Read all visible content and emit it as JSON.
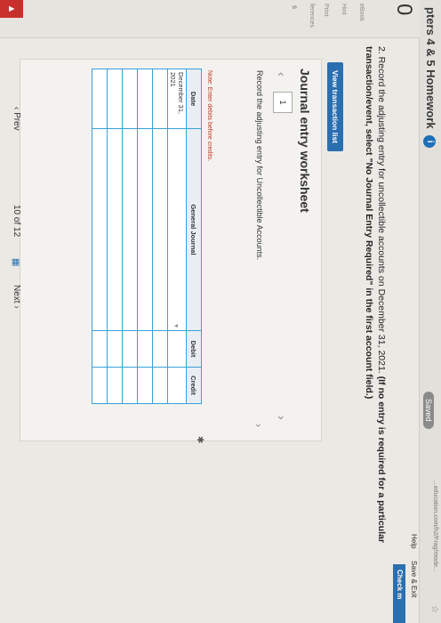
{
  "header": {
    "title": "pters 4 & 5 Homework",
    "info_badge": "i",
    "saved_label": "Saved",
    "url_fragment": "...education.com/h2/Frag/mode...",
    "help_label": "Help",
    "save_exit_label": "Save & Exit",
    "check_label": "Check m"
  },
  "sidebar": {
    "question_number": "0",
    "items": [
      "eBook",
      "Hint",
      "Print",
      "ferences"
    ],
    "section_letter": "s"
  },
  "question": {
    "text_prefix": "2. Record the adjusting entry for uncollectible accounts on December 31, 2021. ",
    "text_bold": "(If no entry is required for a particular transaction/event, select \"No Journal Entry Required\" in the first account field.)"
  },
  "view_transaction_label": "View transaction list",
  "worksheet": {
    "title": "Journal entry worksheet",
    "page": "1",
    "instruction": "Record the adjusting entry for Uncollectible Accounts.",
    "note": "Note: Enter debits before credits.",
    "columns": [
      "Date",
      "General Journal",
      "Debit",
      "Credit"
    ],
    "rows": [
      {
        "date": "December 31, 2021",
        "account": "",
        "debit": "",
        "credit": ""
      },
      {
        "date": "",
        "account": "",
        "debit": "",
        "credit": ""
      },
      {
        "date": "",
        "account": "",
        "debit": "",
        "credit": ""
      },
      {
        "date": "",
        "account": "",
        "debit": "",
        "credit": ""
      },
      {
        "date": "",
        "account": "",
        "debit": "",
        "credit": ""
      },
      {
        "date": "",
        "account": "",
        "debit": "",
        "credit": ""
      }
    ]
  },
  "pagination": {
    "prev_label": "Prev",
    "current": "10",
    "of_label": "of",
    "total": "12",
    "next_label": "Next"
  },
  "colors": {
    "accent": "#2a6fb0",
    "table_border": "#3aa0d8",
    "note": "#c0392b"
  }
}
